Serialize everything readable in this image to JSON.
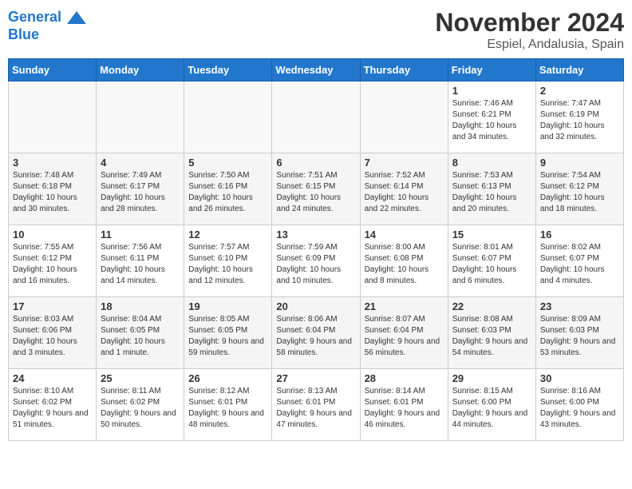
{
  "header": {
    "logo_line1": "General",
    "logo_line2": "Blue",
    "title": "November 2024",
    "subtitle": "Espiel, Andalusia, Spain"
  },
  "weekdays": [
    "Sunday",
    "Monday",
    "Tuesday",
    "Wednesday",
    "Thursday",
    "Friday",
    "Saturday"
  ],
  "weeks": [
    [
      {
        "day": "",
        "info": ""
      },
      {
        "day": "",
        "info": ""
      },
      {
        "day": "",
        "info": ""
      },
      {
        "day": "",
        "info": ""
      },
      {
        "day": "",
        "info": ""
      },
      {
        "day": "1",
        "info": "Sunrise: 7:46 AM\nSunset: 6:21 PM\nDaylight: 10 hours and 34 minutes."
      },
      {
        "day": "2",
        "info": "Sunrise: 7:47 AM\nSunset: 6:19 PM\nDaylight: 10 hours and 32 minutes."
      }
    ],
    [
      {
        "day": "3",
        "info": "Sunrise: 7:48 AM\nSunset: 6:18 PM\nDaylight: 10 hours and 30 minutes."
      },
      {
        "day": "4",
        "info": "Sunrise: 7:49 AM\nSunset: 6:17 PM\nDaylight: 10 hours and 28 minutes."
      },
      {
        "day": "5",
        "info": "Sunrise: 7:50 AM\nSunset: 6:16 PM\nDaylight: 10 hours and 26 minutes."
      },
      {
        "day": "6",
        "info": "Sunrise: 7:51 AM\nSunset: 6:15 PM\nDaylight: 10 hours and 24 minutes."
      },
      {
        "day": "7",
        "info": "Sunrise: 7:52 AM\nSunset: 6:14 PM\nDaylight: 10 hours and 22 minutes."
      },
      {
        "day": "8",
        "info": "Sunrise: 7:53 AM\nSunset: 6:13 PM\nDaylight: 10 hours and 20 minutes."
      },
      {
        "day": "9",
        "info": "Sunrise: 7:54 AM\nSunset: 6:12 PM\nDaylight: 10 hours and 18 minutes."
      }
    ],
    [
      {
        "day": "10",
        "info": "Sunrise: 7:55 AM\nSunset: 6:12 PM\nDaylight: 10 hours and 16 minutes."
      },
      {
        "day": "11",
        "info": "Sunrise: 7:56 AM\nSunset: 6:11 PM\nDaylight: 10 hours and 14 minutes."
      },
      {
        "day": "12",
        "info": "Sunrise: 7:57 AM\nSunset: 6:10 PM\nDaylight: 10 hours and 12 minutes."
      },
      {
        "day": "13",
        "info": "Sunrise: 7:59 AM\nSunset: 6:09 PM\nDaylight: 10 hours and 10 minutes."
      },
      {
        "day": "14",
        "info": "Sunrise: 8:00 AM\nSunset: 6:08 PM\nDaylight: 10 hours and 8 minutes."
      },
      {
        "day": "15",
        "info": "Sunrise: 8:01 AM\nSunset: 6:07 PM\nDaylight: 10 hours and 6 minutes."
      },
      {
        "day": "16",
        "info": "Sunrise: 8:02 AM\nSunset: 6:07 PM\nDaylight: 10 hours and 4 minutes."
      }
    ],
    [
      {
        "day": "17",
        "info": "Sunrise: 8:03 AM\nSunset: 6:06 PM\nDaylight: 10 hours and 3 minutes."
      },
      {
        "day": "18",
        "info": "Sunrise: 8:04 AM\nSunset: 6:05 PM\nDaylight: 10 hours and 1 minute."
      },
      {
        "day": "19",
        "info": "Sunrise: 8:05 AM\nSunset: 6:05 PM\nDaylight: 9 hours and 59 minutes."
      },
      {
        "day": "20",
        "info": "Sunrise: 8:06 AM\nSunset: 6:04 PM\nDaylight: 9 hours and 58 minutes."
      },
      {
        "day": "21",
        "info": "Sunrise: 8:07 AM\nSunset: 6:04 PM\nDaylight: 9 hours and 56 minutes."
      },
      {
        "day": "22",
        "info": "Sunrise: 8:08 AM\nSunset: 6:03 PM\nDaylight: 9 hours and 54 minutes."
      },
      {
        "day": "23",
        "info": "Sunrise: 8:09 AM\nSunset: 6:03 PM\nDaylight: 9 hours and 53 minutes."
      }
    ],
    [
      {
        "day": "24",
        "info": "Sunrise: 8:10 AM\nSunset: 6:02 PM\nDaylight: 9 hours and 51 minutes."
      },
      {
        "day": "25",
        "info": "Sunrise: 8:11 AM\nSunset: 6:02 PM\nDaylight: 9 hours and 50 minutes."
      },
      {
        "day": "26",
        "info": "Sunrise: 8:12 AM\nSunset: 6:01 PM\nDaylight: 9 hours and 48 minutes."
      },
      {
        "day": "27",
        "info": "Sunrise: 8:13 AM\nSunset: 6:01 PM\nDaylight: 9 hours and 47 minutes."
      },
      {
        "day": "28",
        "info": "Sunrise: 8:14 AM\nSunset: 6:01 PM\nDaylight: 9 hours and 46 minutes."
      },
      {
        "day": "29",
        "info": "Sunrise: 8:15 AM\nSunset: 6:00 PM\nDaylight: 9 hours and 44 minutes."
      },
      {
        "day": "30",
        "info": "Sunrise: 8:16 AM\nSunset: 6:00 PM\nDaylight: 9 hours and 43 minutes."
      }
    ]
  ]
}
